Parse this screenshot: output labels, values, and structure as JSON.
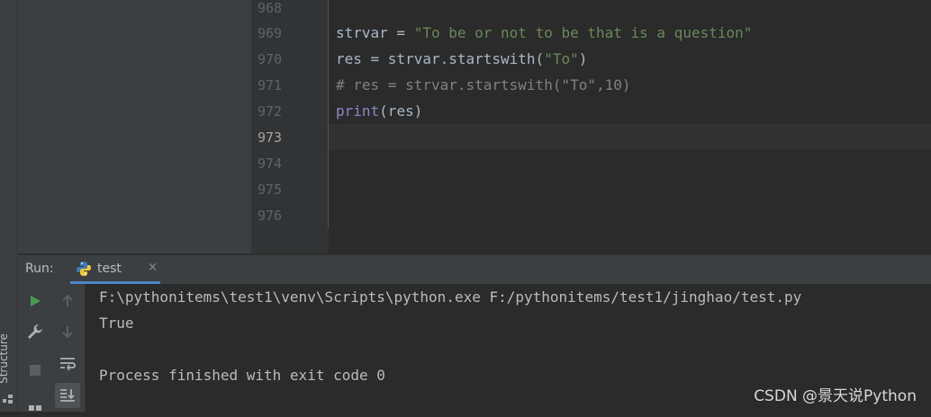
{
  "side_panel": {
    "structure_label": "Structure"
  },
  "editor": {
    "line_numbers": [
      "968",
      "969",
      "970",
      "971",
      "972",
      "973",
      "974",
      "975",
      "976"
    ],
    "current_line": "973",
    "code": {
      "l969_var": "strvar = ",
      "l969_str": "\"To be or not to be that is a question\"",
      "l970_a": "res = strvar.startswith(",
      "l970_str": "\"To\"",
      "l970_b": ")",
      "l971_comment": "# res = strvar.startswith(\"To\",10)",
      "l972_kw": "print",
      "l972_rest": "(res)"
    }
  },
  "run_panel": {
    "label": "Run:",
    "tab_label": "test",
    "tab_close": "×",
    "console_lines": [
      "F:\\pythonitems\\test1\\venv\\Scripts\\python.exe F:/pythonitems/test1/jinghao/test.py",
      "True",
      "",
      "Process finished with exit code 0"
    ]
  },
  "colors": {
    "accent": "#4a88c7",
    "run_green": "#499c54",
    "string": "#6a8759",
    "comment": "#808080",
    "keyword": "#8888c6"
  },
  "watermark": "CSDN @景天说Python"
}
